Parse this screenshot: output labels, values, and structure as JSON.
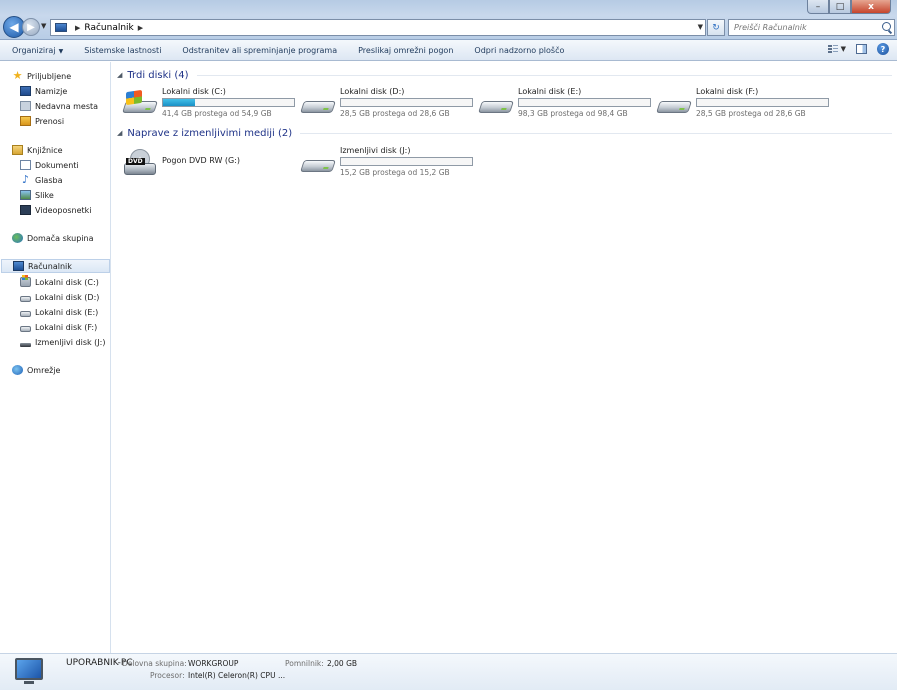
{
  "window": {
    "buttons": {
      "minimize": "–",
      "maximize": "□",
      "close": "x"
    }
  },
  "address": {
    "path": "Računalnik",
    "search_placeholder": "Preišči Računalnik"
  },
  "commands": {
    "organize": "Organiziraj",
    "system_properties": "Sistemske lastnosti",
    "uninstall": "Odstranitev ali spreminjanje programa",
    "map_drive": "Preslikaj omrežni pogon",
    "control_panel": "Odpri nadzorno ploščo"
  },
  "sidebar": {
    "favorites": "Priljubljene",
    "desktop": "Namizje",
    "recent": "Nedavna mesta",
    "downloads": "Prenosi",
    "libraries": "Knjižnice",
    "documents": "Dokumenti",
    "music": "Glasba",
    "pictures": "Slike",
    "videos": "Videoposnetki",
    "homegroup": "Domača skupina",
    "computer": "Računalnik",
    "drive_c": "Lokalni disk (C:)",
    "drive_d": "Lokalni disk (D:)",
    "drive_e": "Lokalni disk (E:)",
    "drive_f": "Lokalni disk (F:)",
    "drive_j": "Izmenljivi disk (J:)",
    "network": "Omrežje"
  },
  "groups": {
    "hard_disks": "Trdi diski (4)",
    "removable": "Naprave z izmenljivimi mediji (2)"
  },
  "drives": [
    {
      "name": "Lokalni disk (C:)",
      "free": "41,4 GB prostega od 54,9 GB",
      "used_fraction": 0.246
    },
    {
      "name": "Lokalni disk (D:)",
      "free": "28,5 GB prostega od 28,6 GB",
      "used_fraction": 0.0
    },
    {
      "name": "Lokalni disk (E:)",
      "free": "98,3 GB prostega od 98,4 GB",
      "used_fraction": 0.0
    },
    {
      "name": "Lokalni disk (F:)",
      "free": "28,5 GB prostega od 28,6 GB",
      "used_fraction": 0.0
    }
  ],
  "removable": {
    "dvd": {
      "name": "Pogon DVD RW (G:)",
      "icon_label": "DVD"
    },
    "usb": {
      "name": "Izmenljivi disk (J:)",
      "free": "15,2 GB prostega od 15,2 GB",
      "used_fraction": 0.0
    }
  },
  "details": {
    "pc_name": "UPORABNIK-PC",
    "workgroup_label": "Delovna skupina:",
    "workgroup": "WORKGROUP",
    "memory_label": "Pomnilnik:",
    "memory": "2,00 GB",
    "cpu_label": "Procesor:",
    "cpu": "Intel(R) Celeron(R) CPU ..."
  },
  "colors": {
    "accent": "#1e3287",
    "bar_fill": "#26a0d6"
  }
}
